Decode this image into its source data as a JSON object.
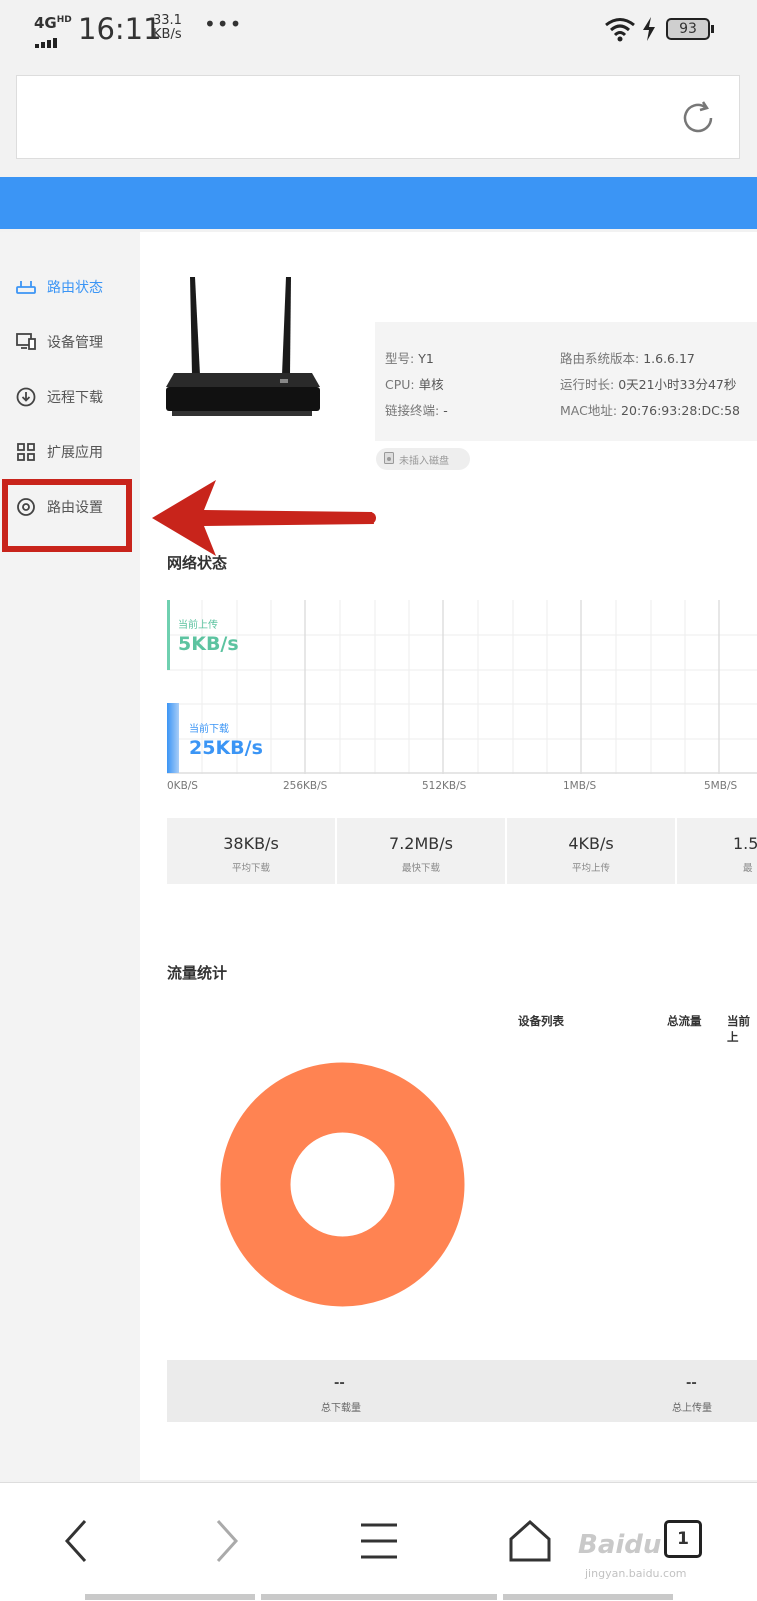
{
  "status_bar": {
    "network": "4G",
    "network_sup": "HD",
    "time": "16:11",
    "speed_value": "33.1",
    "speed_unit": "KB/s",
    "more": "•••",
    "battery": "93"
  },
  "sidebar": {
    "items": [
      {
        "label": "路由状态",
        "icon": "router-icon",
        "active": true
      },
      {
        "label": "设备管理",
        "icon": "devices-icon",
        "active": false
      },
      {
        "label": "远程下载",
        "icon": "download-icon",
        "active": false
      },
      {
        "label": "扩展应用",
        "icon": "apps-grid-icon",
        "active": false
      },
      {
        "label": "路由设置",
        "icon": "settings-icon",
        "active": false
      }
    ]
  },
  "router_info": {
    "model_label": "型号:",
    "model": "Y1",
    "cpu_label": "CPU:",
    "cpu": "单核",
    "link_label": "链接终端:",
    "link": "-",
    "version_label": "路由系统版本:",
    "version": "1.6.6.17",
    "uptime_label": "运行时长:",
    "uptime": "0天21小时33分47秒",
    "mac_label": "MAC地址:",
    "mac": "20:76:93:28:DC:58",
    "disk_status": "未插入磁盘"
  },
  "network_status": {
    "title": "网络状态",
    "upload_caption": "当前上传",
    "upload_value": "5KB/s",
    "download_caption": "当前下载",
    "download_value": "25KB/s",
    "axis_labels": [
      "0KB/S",
      "256KB/S",
      "512KB/S",
      "1MB/S",
      "5MB/S"
    ],
    "stats": [
      {
        "value": "38KB/s",
        "caption": "平均下载"
      },
      {
        "value": "7.2MB/s",
        "caption": "最快下载"
      },
      {
        "value": "4KB/s",
        "caption": "平均上传"
      },
      {
        "value": "1.5",
        "caption": "最"
      }
    ]
  },
  "traffic_stats": {
    "title": "流量统计",
    "columns": [
      "设备列表",
      "总流量",
      "当前上"
    ],
    "total_download_value": "--",
    "total_download_caption": "总下载量",
    "total_upload_value": "--",
    "total_upload_caption": "总上传量",
    "donut_color": "#ff8352"
  },
  "bottom_nav": {
    "tab_count": "1",
    "watermark": "Baidu",
    "watermark_sub": "jingyan.baidu.com"
  },
  "colors": {
    "accent": "#3b95f5",
    "highlight": "#c8241b",
    "upload": "#5cc3a0"
  }
}
